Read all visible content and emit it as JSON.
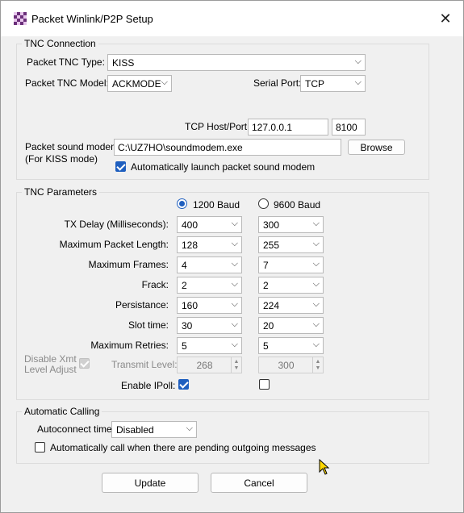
{
  "window": {
    "title": "Packet Winlink/P2P Setup",
    "close_glyph": "✕"
  },
  "tnc_connection": {
    "group_title": "TNC Connection",
    "type_label": "Packet TNC Type:",
    "type_value": "KISS",
    "model_label": "Packet TNC Model:",
    "model_value": "ACKMODE",
    "serial_label": "Serial Port:",
    "serial_value": "TCP",
    "tcp_label": "TCP Host/Port:",
    "tcp_host": "127.0.0.1",
    "tcp_port": "8100",
    "modem_label_1": "Packet sound modem:",
    "modem_label_2": "(For KISS mode)",
    "modem_path": "C:\\UZ7HO\\soundmodem.exe",
    "browse_label": "Browse",
    "auto_launch_label": "Automatically launch packet sound modem",
    "auto_launch_checked": true
  },
  "tnc_parameters": {
    "group_title": "TNC Parameters",
    "baud_1200_label": "1200 Baud",
    "baud_9600_label": "9600 Baud",
    "baud_selected": "1200",
    "rows": [
      {
        "label": "TX Delay (Milliseconds):",
        "v1200": "400",
        "v9600": "300"
      },
      {
        "label": "Maximum Packet Length:",
        "v1200": "128",
        "v9600": "255"
      },
      {
        "label": "Maximum Frames:",
        "v1200": "4",
        "v9600": "7"
      },
      {
        "label": "Frack:",
        "v1200": "2",
        "v9600": "2"
      },
      {
        "label": "Persistance:",
        "v1200": "160",
        "v9600": "224"
      },
      {
        "label": "Slot time:",
        "v1200": "30",
        "v9600": "20"
      },
      {
        "label": "Maximum Retries:",
        "v1200": "5",
        "v9600": "5"
      }
    ],
    "disable_xmt_label_1": "Disable Xmt",
    "disable_xmt_label_2": "Level Adjust",
    "transmit_level_label": "Transmit Level:",
    "transmit_1200": "268",
    "transmit_9600": "300",
    "ipoll_label": "Enable IPoll:",
    "ipoll_1200": true,
    "ipoll_9600": false
  },
  "automatic_calling": {
    "group_title": "Automatic Calling",
    "autoconnect_label": "Autoconnect time:",
    "autoconnect_value": "Disabled",
    "auto_call_label": "Automatically call when there are pending outgoing messages",
    "auto_call_checked": false
  },
  "footer": {
    "update_label": "Update",
    "cancel_label": "Cancel"
  },
  "colors": {
    "accent": "#1f5fbf",
    "dialog_bg": "#f0f0f0"
  }
}
